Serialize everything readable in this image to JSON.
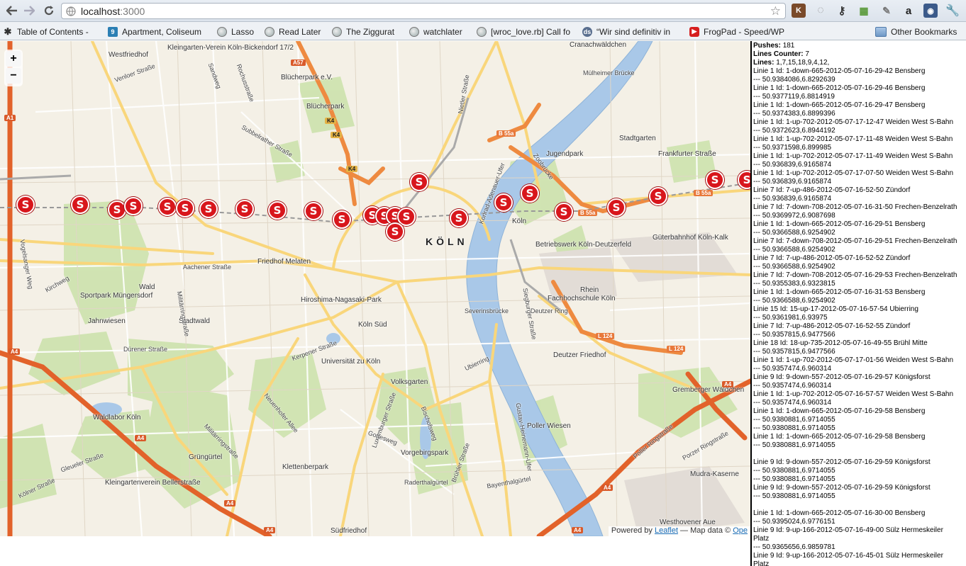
{
  "browser": {
    "url_host": "localhost",
    "url_port": ":3000",
    "back_icon": "back-arrow-icon",
    "forward_icon": "forward-arrow-icon",
    "reload_icon": "reload-icon"
  },
  "bookmarks": {
    "items": [
      {
        "label": "Table of Contents -",
        "icon": "snowflake-icon"
      },
      {
        "label": "Apartment, Coliseum",
        "icon": "nine-icon"
      },
      {
        "label": "Lasso",
        "icon": "globe-icon"
      },
      {
        "label": "Read Later",
        "icon": "globe-icon"
      },
      {
        "label": "The Ziggurat",
        "icon": "globe-icon"
      },
      {
        "label": "watchlater",
        "icon": "globe-icon"
      },
      {
        "label": "[wroc_love.rb] Call fo",
        "icon": "globe-icon"
      },
      {
        "label": "“Wir sind definitiv in",
        "icon": "ds-icon"
      },
      {
        "label": "FrogPad - Speed/WP",
        "icon": "youtube-icon"
      }
    ],
    "more": "»",
    "other": "Other Bookmarks"
  },
  "map": {
    "zoom_in": "+",
    "zoom_out": "−",
    "city_label": "KÖLN",
    "marker_letter": "S",
    "attribution_prefix": "Powered by ",
    "attribution_link": "Leaflet",
    "attribution_suffix": " — Map data © ",
    "attribution_ope": "Ope",
    "labels": [
      "Westfriedhof",
      "Kleingarten-Verein Köln-Bickendorf 17/2",
      "Blücherpark e.V.",
      "Blücherpark",
      "Cranachwäldchen",
      "Jugendpark",
      "Stadtgarten",
      "Frankfurter Straße",
      "Friedhof Melaten",
      "Aachener Straße",
      "Sportpark Müngersdorf",
      "Wald",
      "Jahnwiesen",
      "Stadtwald",
      "Hiroshima-Nagasaki-Park",
      "Dürener Straße",
      "Köln Süd",
      "Universität zu Köln",
      "Volksgarten",
      "Poller Wiesen",
      "Fachhochschule Köln",
      "Deutzer Ring",
      "Deutzer Friedhof",
      "Gremberger Wäldchen",
      "Waldlabor Köln",
      "Grüngürtel",
      "Klettenberpark",
      "Vorgebirgspark",
      "Kleingartenverein Bellerstraße",
      "Westhovener Aue",
      "Südfriedhof",
      "Mudra-Kaserne",
      "Güterbahnhof Köln-Kalk",
      "Betriebswerk Köln-Deutzerfeld",
      "Köln",
      "Rhein",
      "Severinsbrücke",
      "Mülheimer Brücke",
      "Zoobrücke",
      "Militärringstraße",
      "Neuenhofer Allee",
      "Luxemburger Straße",
      "Bischofsweg",
      "Gottesweg",
      "Raderthalgürtel",
      "Bayenthalgürtel",
      "Kerpener Straße",
      "Ubierring",
      "Poller Ringstraße",
      "Porzer Ringstraße",
      "Vogelsanger Weg",
      "Kirchweg",
      "Gleueler Straße",
      "Kölner Straße",
      "Venloer Straße",
      "Subbelrather Straße",
      "Nietler Straße",
      "Konrad-Adenauer-Ufer",
      "Gustav-Heinemann-Ufer",
      "Siegburger Straße",
      "Brühler Straße",
      "Sandweg",
      "Rochusstraße",
      "Militärringstraße"
    ],
    "shields": [
      "A1",
      "A57",
      "K4",
      "K4",
      "K4",
      "B 55a",
      "B 55a",
      "B 55a",
      "A4",
      "A4",
      "A4",
      "A4",
      "A4",
      "L 124",
      "L 124",
      "A4",
      "A4"
    ]
  },
  "panel": {
    "pushes_label": "Pushes:",
    "pushes_value": "181",
    "lines_counter_label": "Lines Counter:",
    "lines_counter_value": "7",
    "lines_label": "Lines:",
    "lines_value": "1,7,15,18,9,4,12,",
    "entries": [
      "Linie 1 Id: 1-down-665-2012-05-07-16-29-42 Bensberg",
      "--- 50.9384086,6.8292639",
      "Linie 1 Id: 1-down-665-2012-05-07-16-29-46 Bensberg",
      "--- 50.9377119,6.8814919",
      "Linie 1 Id: 1-down-665-2012-05-07-16-29-47 Bensberg",
      "--- 50.9374383,6.8899396",
      "Linie 1 Id: 1-up-702-2012-05-07-17-12-47 Weiden West S-Bahn",
      "--- 50.9372623,6.8944192",
      "Linie 1 Id: 1-up-702-2012-05-07-17-11-48 Weiden West S-Bahn",
      "--- 50.9371598,6.899985",
      "Linie 1 Id: 1-up-702-2012-05-07-17-11-49 Weiden West S-Bahn",
      "--- 50.936839,6.9165874",
      "Linie 1 Id: 1-up-702-2012-05-07-17-07-50 Weiden West S-Bahn",
      "--- 50.936839,6.9165874",
      "Linie 7 Id: 7-up-486-2012-05-07-16-52-50 Zündorf",
      "--- 50.936839,6.9165874",
      "Linie 7 Id: 7-down-708-2012-05-07-16-31-50 Frechen-Benzelrath",
      "--- 50.9369972,6.9087698",
      "Linie 1 Id: 1-down-665-2012-05-07-16-29-51 Bensberg",
      "--- 50.9366588,6.9254902",
      "Linie 7 Id: 7-down-708-2012-05-07-16-29-51 Frechen-Benzelrath",
      "--- 50.9366588,6.9254902",
      "Linie 7 Id: 7-up-486-2012-05-07-16-52-52 Zündorf",
      "--- 50.9366588,6.9254902",
      "Linie 7 Id: 7-down-708-2012-05-07-16-29-53 Frechen-Benzelrath",
      "--- 50.9355383,6.9323815",
      "Linie 1 Id: 1-down-665-2012-05-07-16-31-53 Bensberg",
      "--- 50.9366588,6.9254902",
      "Linie 15 Id: 15-up-17-2012-05-07-16-57-54 Ubierring",
      "--- 50.9361981,6.93975",
      "Linie 7 Id: 7-up-486-2012-05-07-16-52-55 Zündorf",
      "--- 50.9357815,6.9477566",
      "Linie 18 Id: 18-up-735-2012-05-07-16-49-55 Brühl Mitte",
      "--- 50.9357815,6.9477566",
      "Linie 1 Id: 1-up-702-2012-05-07-17-01-56 Weiden West S-Bahn",
      "--- 50.9357474,6.960314",
      "Linie 9 Id: 9-down-557-2012-05-07-16-29-57 Königsforst",
      "--- 50.9357474,6.960314",
      "Linie 1 Id: 1-up-702-2012-05-07-16-57-57 Weiden West S-Bahn",
      "--- 50.9357474,6.960314",
      "Linie 1 Id: 1-down-665-2012-05-07-16-29-58 Bensberg",
      "--- 50.9380881,6.9714055",
      "--- 50.9380881,6.9714055",
      "Linie 1 Id: 1-down-665-2012-05-07-16-29-58 Bensberg",
      "--- 50.9380881,6.9714055",
      "",
      "Linie 9 Id: 9-down-557-2012-05-07-16-29-59 Königsforst",
      "--- 50.9380881,6.9714055",
      "--- 50.9380881,6.9714055",
      "Linie 9 Id: 9-down-557-2012-05-07-16-29-59 Königsforst",
      "--- 50.9380881,6.9714055",
      "",
      "Linie 1 Id: 1-down-665-2012-05-07-16-30-00 Bensberg",
      "--- 50.9395024,6.9776151",
      "Linie 9 Id: 9-up-166-2012-05-07-16-49-00 Sülz Hermeskeiler",
      "Platz",
      "--- 50.9365656,6.9859781",
      "Linie 9 Id: 9-up-166-2012-05-07-16-45-01 Sülz Hermeskeiler",
      "Platz"
    ]
  }
}
